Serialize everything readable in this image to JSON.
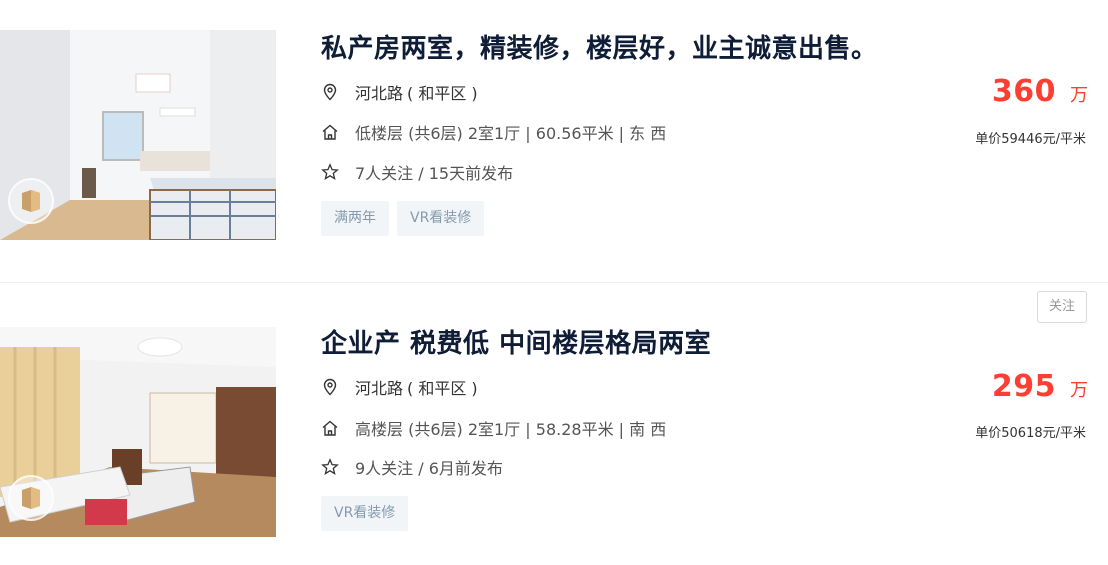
{
  "listings": [
    {
      "title": "私产房两室，精装修，楼层好，业主诚意出售。",
      "address": {
        "street": "河北路",
        "district": "( 和平区 )"
      },
      "house_info": "低楼层 (共6层) 2室1厅 | 60.56平米 | 东 西",
      "follow_info": "7人关注 / 15天前发布",
      "tags": [
        "满两年",
        "VR看装修"
      ],
      "price": {
        "total": "360",
        "unit": "万"
      },
      "unit_price": "单价59446元/平米",
      "icons": {
        "location": "location-pin-icon",
        "house": "house-icon",
        "follow": "star-icon",
        "vr": "vr-icon"
      }
    },
    {
      "title": "企业产 税费低 中间楼层格局两室",
      "address": {
        "street": "河北路",
        "district": "( 和平区 )"
      },
      "house_info": "高楼层 (共6层) 2室1厅 | 58.28平米 | 南 西",
      "follow_info": "9人关注 / 6月前发布",
      "tags": [
        "VR看装修"
      ],
      "price": {
        "total": "295",
        "unit": "万"
      },
      "unit_price": "单价50618元/平米",
      "follow_button": "关注",
      "icons": {
        "location": "location-pin-icon",
        "house": "house-icon",
        "follow": "star-icon",
        "vr": "vr-icon"
      }
    }
  ],
  "colors": {
    "title": "#101d37",
    "price": "#fe3e32",
    "tag_bg": "#f2f5f7",
    "tag_text": "#849aae"
  }
}
